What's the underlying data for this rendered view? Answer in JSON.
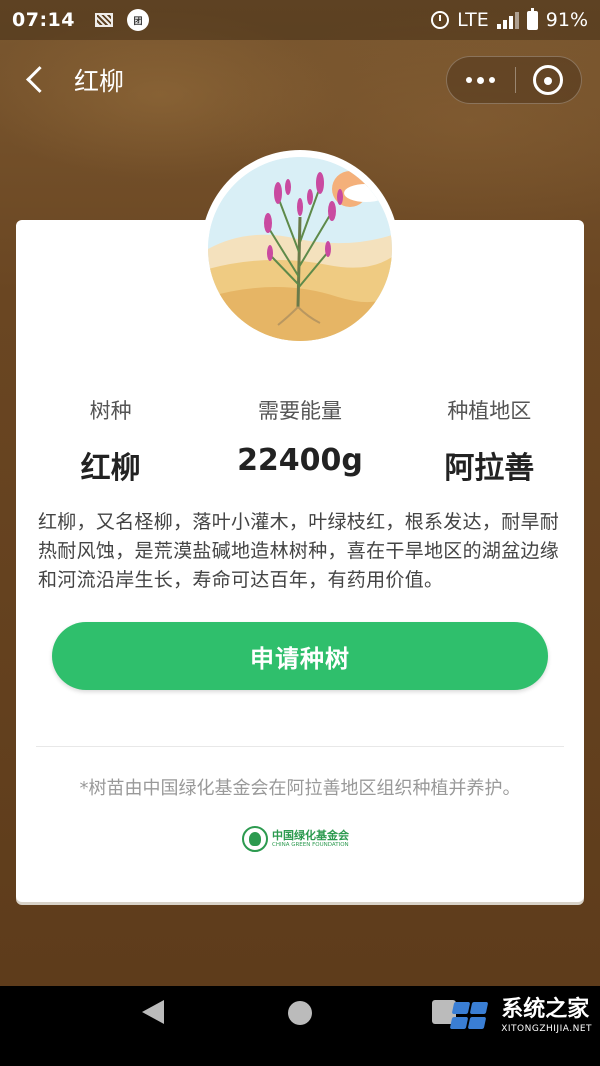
{
  "status_bar": {
    "time": "07:14",
    "network": "LTE",
    "battery": "91%",
    "app_icon_text": "团"
  },
  "header": {
    "title": "红柳",
    "more_icon": "ellipsis-icon",
    "close_icon": "miniprogram-close-icon"
  },
  "stats": [
    {
      "label": "树种",
      "value": "红柳"
    },
    {
      "label": "需要能量",
      "value": "22400g"
    },
    {
      "label": "种植地区",
      "value": "阿拉善"
    }
  ],
  "description": "红柳，又名柽柳，落叶小灌木，叶绿枝红，根系发达，耐旱耐热耐风蚀，是荒漠盐碱地造林树种，喜在干旱地区的湖盆边缘和河流沿岸生长，寿命可达百年，有药用价值。",
  "apply_button": "申请种树",
  "footnote": "*树苗由中国绿化基金会在阿拉善地区组织种植并养护。",
  "foundation": {
    "name_cn": "中国绿化基金会",
    "name_en": "CHINA GREEN FOUNDATION"
  },
  "watermark": {
    "cn": "系统之家",
    "en": "XITONGZHIJIA.NET"
  },
  "colors": {
    "accent_green": "#2fbf6c",
    "background_brown": "#6b4a26"
  }
}
